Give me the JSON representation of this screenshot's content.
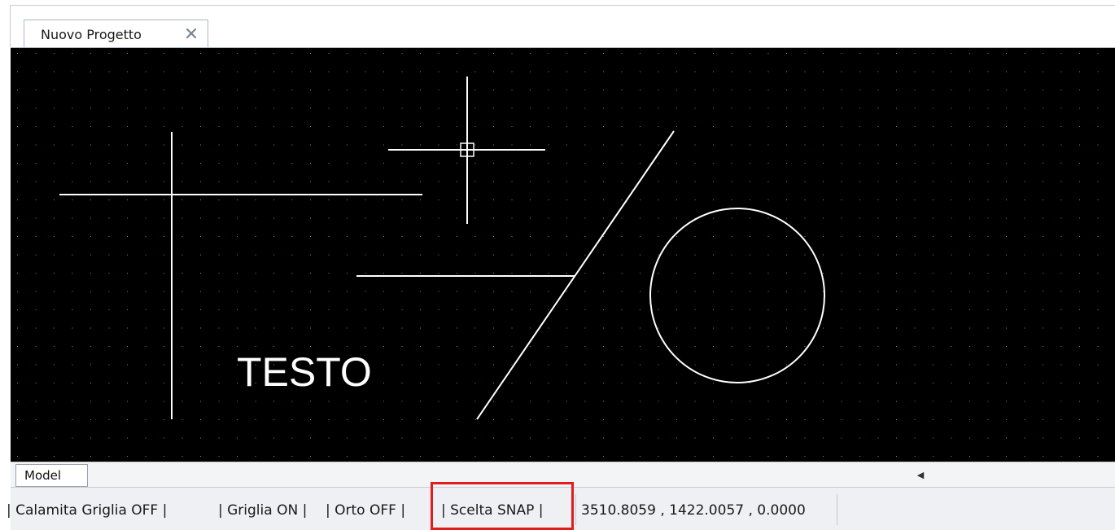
{
  "document_tab": {
    "title": "Nuovo Progetto",
    "close_icon": "close-icon"
  },
  "canvas": {
    "background": "#000000",
    "grid_dot_color": "#c8742a",
    "entity_color": "#ffffff",
    "text_entity": "TESTO",
    "cursor_icon": "crosshair-cursor-icon"
  },
  "layout_tabs": {
    "model_label": "Model",
    "scroll_left_icon": "scroll-left-arrow-icon"
  },
  "status_bar": {
    "snap_grid": "| Calamita Griglia OFF |",
    "grid": "| Griglia ON |",
    "ortho": "| Orto OFF |",
    "snap_select": "| Scelta SNAP |",
    "coordinates": "3510.8059 , 1422.0057 , 0.0000"
  },
  "highlight_color": "#e31b1b"
}
